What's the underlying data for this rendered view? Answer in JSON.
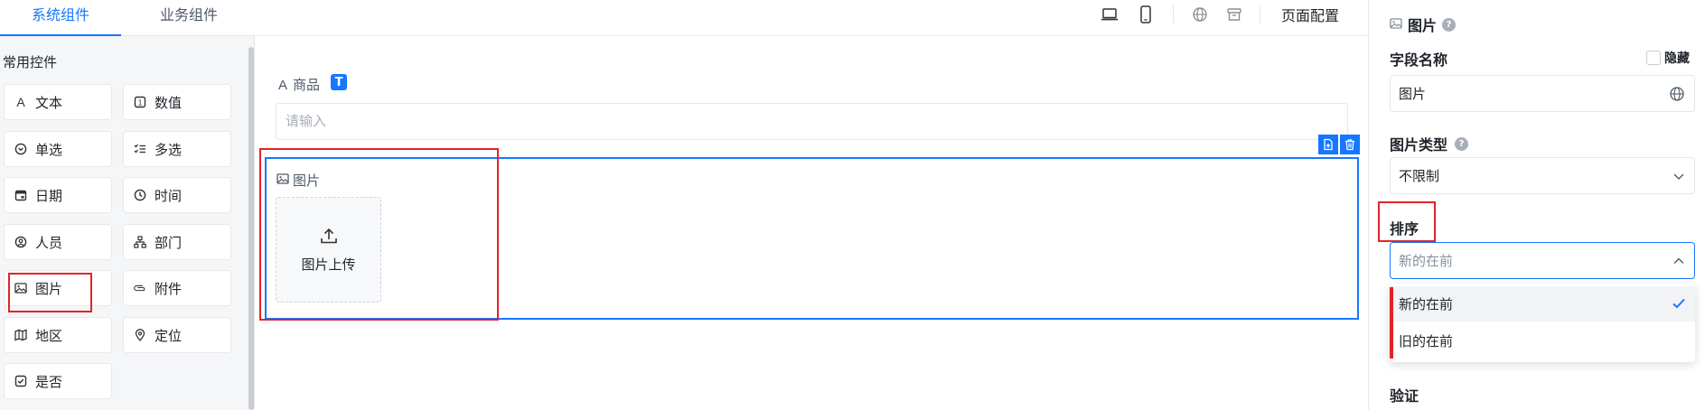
{
  "left_panel": {
    "tabs": [
      {
        "label": "系统组件",
        "active": true
      },
      {
        "label": "业务组件",
        "active": false
      }
    ],
    "section_title": "常用控件",
    "components": [
      {
        "label": "文本",
        "icon": "text-icon"
      },
      {
        "label": "数值",
        "icon": "number-icon"
      },
      {
        "label": "单选",
        "icon": "radio-icon"
      },
      {
        "label": "多选",
        "icon": "checklist-icon"
      },
      {
        "label": "日期",
        "icon": "calendar-icon"
      },
      {
        "label": "时间",
        "icon": "clock-icon"
      },
      {
        "label": "人员",
        "icon": "user-icon"
      },
      {
        "label": "部门",
        "icon": "org-icon"
      },
      {
        "label": "图片",
        "icon": "image-icon"
      },
      {
        "label": "附件",
        "icon": "attachment-icon"
      },
      {
        "label": "地区",
        "icon": "map-icon"
      },
      {
        "label": "定位",
        "icon": "location-pin-icon"
      },
      {
        "label": "是否",
        "icon": "checkbox-icon"
      }
    ]
  },
  "canvas": {
    "toolbar": {
      "icons": [
        "laptop-icon",
        "mobile-icon",
        "globe-icon",
        "archive-icon"
      ],
      "page_config_label": "页面配置"
    },
    "product_field": {
      "label_prefix": "A",
      "label": "商品",
      "badge": "T",
      "placeholder": "请输入"
    },
    "image_field": {
      "label": "图片",
      "upload_label": "图片上传"
    }
  },
  "right_panel": {
    "title": "图片",
    "field_name_label": "字段名称",
    "hide_label": "隐藏",
    "field_name_value": "图片",
    "image_type_label": "图片类型",
    "image_type_value": "不限制",
    "sort_label": "排序",
    "sort_value": "新的在前",
    "sort_options": [
      {
        "label": "新的在前",
        "selected": true
      },
      {
        "label": "旧的在前",
        "selected": false
      }
    ],
    "validation_label": "验证"
  },
  "colors": {
    "accent": "#1677ff",
    "highlight_red": "#e0242a"
  }
}
